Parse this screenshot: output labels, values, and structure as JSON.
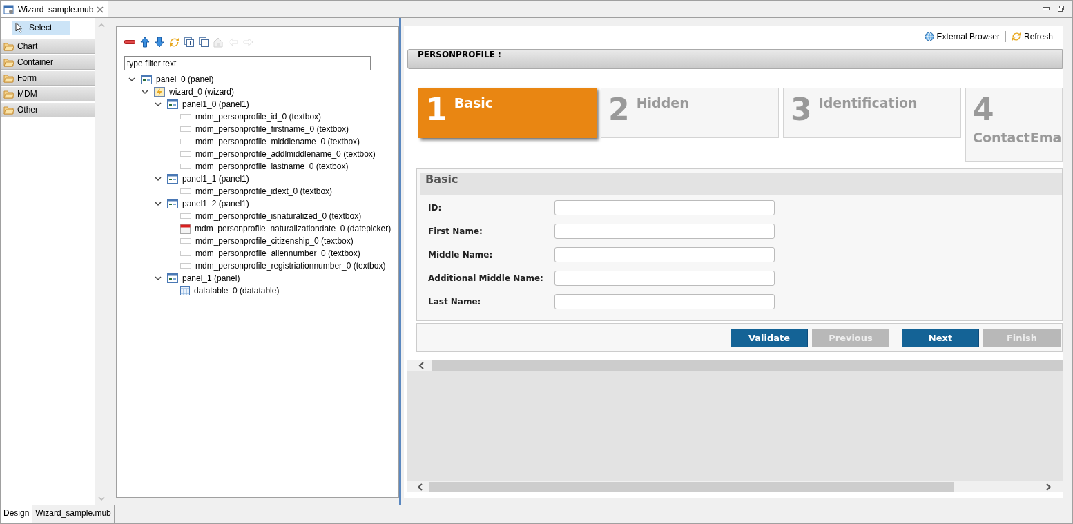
{
  "editor_tab": {
    "title": "Wizard_sample.mub",
    "selected": true
  },
  "palette": {
    "select": {
      "label": "Select",
      "selected": true
    },
    "drawers": [
      {
        "label": "Chart"
      },
      {
        "label": "Container"
      },
      {
        "label": "Form"
      },
      {
        "label": "MDM"
      },
      {
        "label": "Other"
      }
    ]
  },
  "outline": {
    "toolbar": [
      {
        "kind": "remove",
        "disabled": false
      },
      {
        "kind": "up",
        "disabled": false
      },
      {
        "kind": "down",
        "disabled": false
      },
      {
        "kind": "refresh",
        "disabled": false
      },
      {
        "kind": "expand",
        "disabled": false
      },
      {
        "kind": "collapse",
        "disabled": false
      },
      {
        "kind": "home",
        "disabled": true
      },
      {
        "kind": "back",
        "disabled": true
      },
      {
        "kind": "forward",
        "disabled": true
      }
    ],
    "filter": {
      "placeholder": "type filter text"
    },
    "tree": [
      {
        "label": "panel_0 (panel)",
        "kind": "panel",
        "expanded": true,
        "children": [
          {
            "label": "wizard_0 (wizard)",
            "kind": "wizard",
            "expanded": true,
            "children": [
              {
                "label": "panel1_0 (panel1)",
                "kind": "panel",
                "expanded": true,
                "children": [
                  {
                    "label": "mdm_personprofile_id_0 (textbox)",
                    "kind": "textbox"
                  },
                  {
                    "label": "mdm_personprofile_firstname_0 (textbox)",
                    "kind": "textbox"
                  },
                  {
                    "label": "mdm_personprofile_middlename_0 (textbox)",
                    "kind": "textbox"
                  },
                  {
                    "label": "mdm_personprofile_addlmiddlename_0 (textbox)",
                    "kind": "textbox"
                  },
                  {
                    "label": "mdm_personprofile_lastname_0 (textbox)",
                    "kind": "textbox"
                  }
                ]
              },
              {
                "label": "panel1_1 (panel1)",
                "kind": "panel",
                "expanded": true,
                "children": [
                  {
                    "label": "mdm_personprofile_idext_0 (textbox)",
                    "kind": "textbox"
                  }
                ]
              },
              {
                "label": "panel1_2 (panel1)",
                "kind": "panel",
                "expanded": true,
                "children": [
                  {
                    "label": "mdm_personprofile_isnaturalized_0 (textbox)",
                    "kind": "textbox"
                  },
                  {
                    "label": "mdm_personprofile_naturalizationdate_0 (datepicker)",
                    "kind": "datepicker"
                  },
                  {
                    "label": "mdm_personprofile_citizenship_0 (textbox)",
                    "kind": "textbox"
                  },
                  {
                    "label": "mdm_personprofile_aliennumber_0 (textbox)",
                    "kind": "textbox"
                  },
                  {
                    "label": "mdm_personprofile_registriationnumber_0 (textbox)",
                    "kind": "textbox"
                  }
                ]
              },
              {
                "label": "panel_1 (panel)",
                "kind": "panel",
                "expanded": true,
                "children": [
                  {
                    "label": "datatable_0 (datatable)",
                    "kind": "datatable"
                  }
                ]
              }
            ]
          }
        ]
      }
    ]
  },
  "preview": {
    "actions": [
      {
        "label": "External Browser",
        "kind": "browser"
      },
      {
        "label": "Refresh",
        "kind": "refresh"
      }
    ],
    "title": "PERSONPROFILE :",
    "steps": [
      {
        "number": "1",
        "label": "Basic",
        "selected": true
      },
      {
        "number": "2",
        "label": "Hidden",
        "selected": false
      },
      {
        "number": "3",
        "label": "Identification",
        "selected": false
      },
      {
        "number": "4",
        "label": "ContactEma",
        "selected": false
      }
    ],
    "section": "Basic",
    "fields": [
      {
        "label": "ID:"
      },
      {
        "label": "First Name:"
      },
      {
        "label": "Middle Name:"
      },
      {
        "label": "Additional Middle Name:"
      },
      {
        "label": "Last Name:"
      }
    ],
    "buttons": [
      {
        "label": "Validate",
        "disabled": false
      },
      {
        "label": "Previous",
        "disabled": true
      },
      {
        "label": "Next",
        "disabled": false
      },
      {
        "label": "Finish",
        "disabled": true
      }
    ]
  },
  "bottom_tabs": [
    {
      "label": "Design",
      "selected": true
    },
    {
      "label": "Wizard_sample.mub",
      "selected": false
    }
  ]
}
